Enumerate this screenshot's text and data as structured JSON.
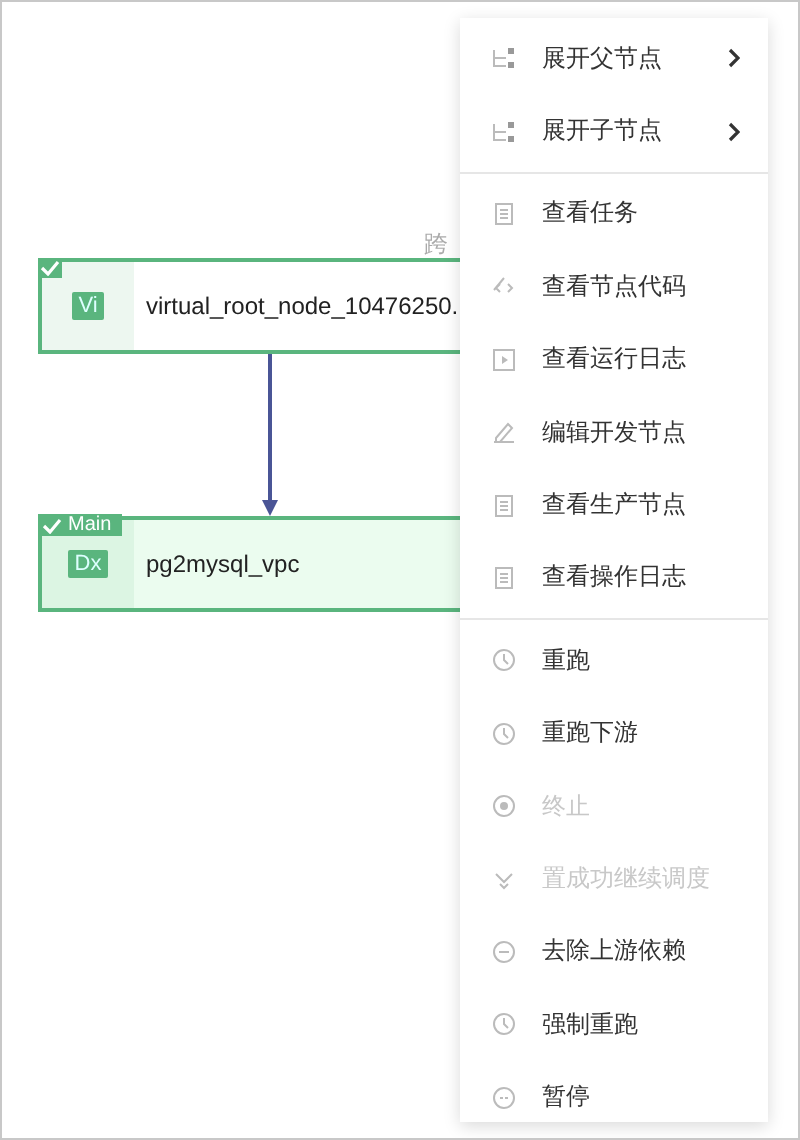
{
  "canvas": {
    "edge_label": "跨",
    "nodes": [
      {
        "badge": "Vi",
        "name": "virtual_root_node_10476250.",
        "checked": true,
        "main": false
      },
      {
        "badge": "Dx",
        "name": "pg2mysql_vpc",
        "tag": "Main",
        "checked": true,
        "main": true
      }
    ]
  },
  "menu": {
    "groups": [
      {
        "items": [
          {
            "label": "展开父节点",
            "submenu": true,
            "disabled": false
          },
          {
            "label": "展开子节点",
            "submenu": true,
            "disabled": false
          }
        ]
      },
      {
        "items": [
          {
            "label": "查看任务",
            "submenu": false,
            "disabled": false
          },
          {
            "label": "查看节点代码",
            "submenu": false,
            "disabled": false
          },
          {
            "label": "查看运行日志",
            "submenu": false,
            "disabled": false
          },
          {
            "label": "编辑开发节点",
            "submenu": false,
            "disabled": false
          },
          {
            "label": "查看生产节点",
            "submenu": false,
            "disabled": false
          },
          {
            "label": "查看操作日志",
            "submenu": false,
            "disabled": false
          }
        ]
      },
      {
        "items": [
          {
            "label": "重跑",
            "submenu": false,
            "disabled": false
          },
          {
            "label": "重跑下游",
            "submenu": false,
            "disabled": false
          },
          {
            "label": "终止",
            "submenu": false,
            "disabled": true
          },
          {
            "label": "置成功继续调度",
            "submenu": false,
            "disabled": true
          },
          {
            "label": "去除上游依赖",
            "submenu": false,
            "disabled": false
          },
          {
            "label": "强制重跑",
            "submenu": false,
            "disabled": false
          },
          {
            "label": "暂停",
            "submenu": false,
            "disabled": false
          }
        ]
      }
    ]
  }
}
